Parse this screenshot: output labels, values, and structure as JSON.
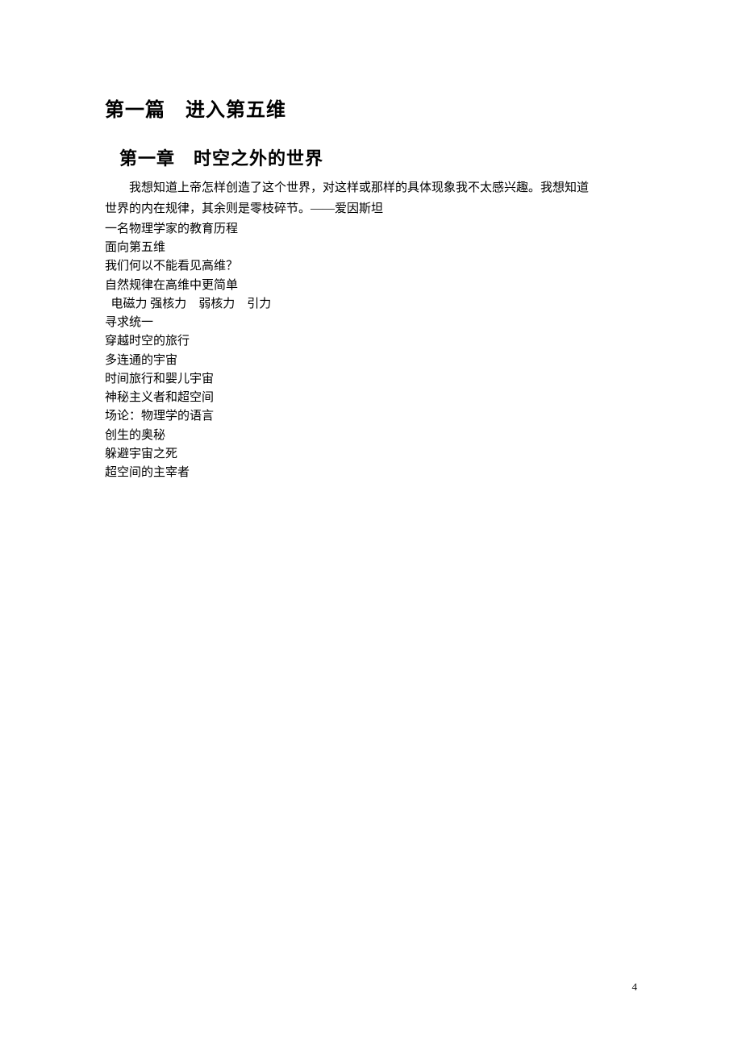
{
  "part_title": "第一篇　进入第五维",
  "chapter_title": "第一章　时空之外的世界",
  "quote_line1": "我想知道上帝怎样创造了这个世界，对这样或那样的具体现象我不太感兴趣。我想知道",
  "quote_line2": "世界的内在规律，其余则是零枝碎节。——爱因斯坦",
  "lines": [
    "一名物理学家的教育历程",
    "面向第五维",
    "我们何以不能看见高维？",
    "自然规律在高维中更简单"
  ],
  "forces_line": "电磁力  强核力　弱核力　引力",
  "lines2": [
    "寻求统一",
    "穿越时空的旅行",
    "多连通的宇宙",
    "时间旅行和婴儿宇宙",
    "神秘主义者和超空间",
    "场论：物理学的语言",
    "创生的奥秘",
    "躲避宇宙之死",
    "超空间的主宰者"
  ],
  "page_number": "4"
}
